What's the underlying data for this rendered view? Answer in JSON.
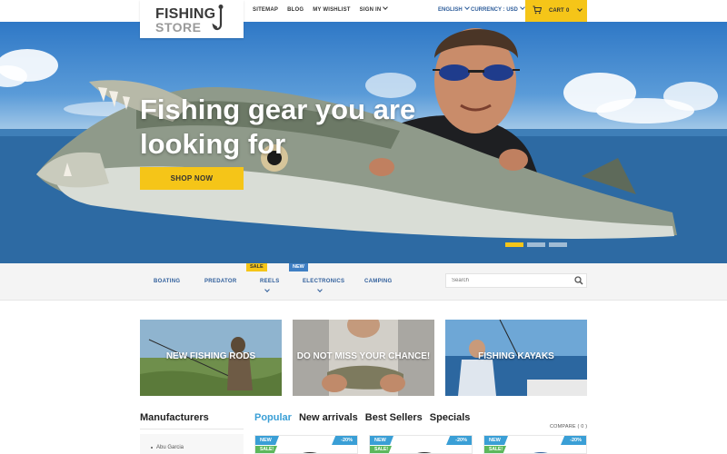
{
  "header": {
    "logo": {
      "line1": "FISHING",
      "line2": "STORE",
      "icon": "fishhook-icon"
    },
    "nav": [
      "SITEMAP",
      "BLOG",
      "MY WISHLIST",
      "SIGN IN"
    ],
    "language": "ENGLISH",
    "currency": "CURRENCY : USD",
    "cart": {
      "label": "CART",
      "count": "0",
      "icon": "cart-icon"
    }
  },
  "hero": {
    "title_line1": "Fishing gear you are",
    "title_line2": "looking for",
    "button": "SHOP NOW",
    "slides": 3,
    "active_slide": 1
  },
  "categories": {
    "items": [
      {
        "label": "BOATING"
      },
      {
        "label": "PREDATOR"
      },
      {
        "label": "REELS",
        "badge": "SALE",
        "has_dropdown": true
      },
      {
        "label": "ELECTRONICS",
        "badge": "NEW",
        "has_dropdown": true
      },
      {
        "label": "CAMPING"
      }
    ],
    "search_placeholder": "Search"
  },
  "banners": [
    {
      "label": "NEW FISHING RODS"
    },
    {
      "label": "DO NOT MISS YOUR CHANCE!"
    },
    {
      "label": "FISHING KAYAKS"
    }
  ],
  "manufacturers": {
    "title": "Manufacturers",
    "items": [
      "Abu Garcia"
    ]
  },
  "product_tabs": [
    "Popular",
    "New arrivals",
    "Best Sellers",
    "Specials"
  ],
  "compare": "COMPARE ( 0 )",
  "products": [
    {
      "badge_new": "NEW",
      "badge_sale": "SALE!",
      "discount": "-20%"
    },
    {
      "badge_new": "NEW",
      "badge_sale": "SALE!",
      "discount": "-20%"
    },
    {
      "badge_new": "NEW",
      "badge_sale": "SALE!",
      "discount": "-20%"
    }
  ],
  "colors": {
    "accent_yellow": "#f5c518",
    "link_blue": "#2f5e9b",
    "tab_blue": "#3a9fd6",
    "sale_green": "#5cb85c"
  }
}
